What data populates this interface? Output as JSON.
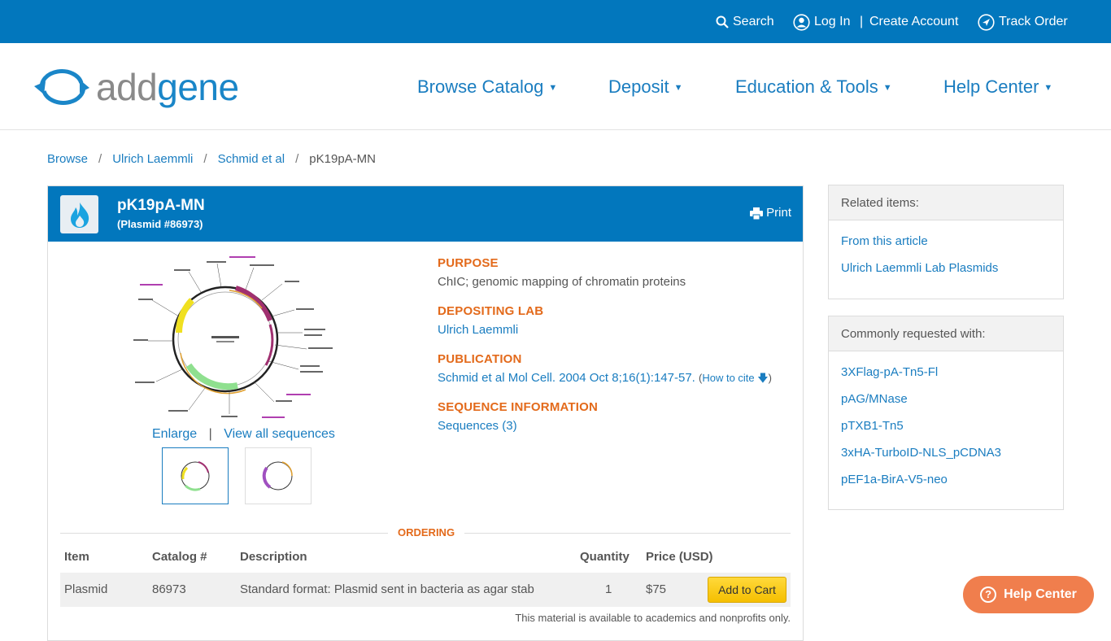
{
  "topbar": {
    "search": "Search",
    "login": "Log In",
    "separator": "|",
    "create_account": "Create Account",
    "track_order": "Track Order"
  },
  "logo": {
    "part1": "add",
    "part2": "gene"
  },
  "nav": [
    {
      "label": "Browse Catalog"
    },
    {
      "label": "Deposit"
    },
    {
      "label": "Education & Tools"
    },
    {
      "label": "Help Center"
    }
  ],
  "breadcrumb": [
    "Browse",
    "Ulrich Laemmli",
    "Schmid et al",
    "pK19pA-MN"
  ],
  "plasmid": {
    "name": "pK19pA-MN",
    "subtitle": "(Plasmid #86973)",
    "print": "Print"
  },
  "map": {
    "enlarge": "Enlarge",
    "separator": "|",
    "view_all": "View all sequences"
  },
  "info": {
    "purpose_label": "PURPOSE",
    "purpose": "ChIC; genomic mapping of chromatin proteins",
    "lab_label": "DEPOSITING LAB",
    "lab": "Ulrich Laemmli",
    "pub_label": "PUBLICATION",
    "pub": "Schmid et al Mol Cell. 2004 Oct 8;16(1):147-57.",
    "cite_open": "(",
    "cite": "How to cite",
    "cite_close": ")",
    "seq_label": "SEQUENCE INFORMATION",
    "seq": "Sequences (3)"
  },
  "ordering": {
    "label": "ORDERING",
    "headers": [
      "Item",
      "Catalog #",
      "Description",
      "Quantity",
      "Price (USD)"
    ],
    "row": {
      "item": "Plasmid",
      "catalog": "86973",
      "description": "Standard format: Plasmid sent in bacteria as agar stab",
      "quantity": "1",
      "price": "$75"
    },
    "cart_button": "Add to Cart",
    "availability": "This material is available to academics and nonprofits only."
  },
  "related": {
    "title": "Related items:",
    "items": [
      "From this article",
      "Ulrich Laemmli Lab Plasmids"
    ]
  },
  "common": {
    "title": "Commonly requested with:",
    "items": [
      "3XFlag-pA-Tn5-Fl",
      "pAG/MNase",
      "pTXB1-Tn5",
      "3xHA-TurboID-NLS_pCDNA3",
      "pEF1a-BirA-V5-neo"
    ]
  },
  "help_center": "Help Center",
  "colors": {
    "brand_blue": "#0277bd",
    "link": "#1a7dc0",
    "accent_orange": "#e36a1b",
    "help_orange": "#f07e4d",
    "cart_yellow": "#f5bf00"
  }
}
